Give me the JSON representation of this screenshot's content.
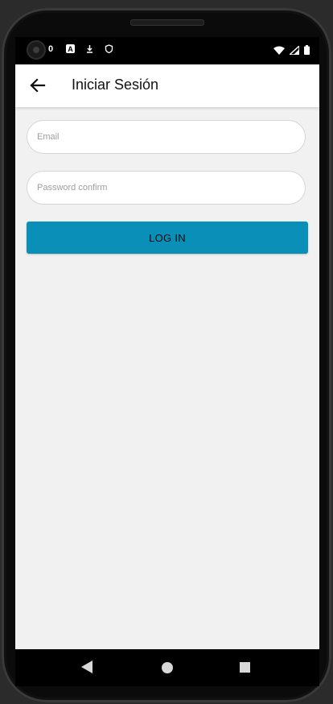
{
  "status_bar": {
    "left_text": "0",
    "icons": [
      "camera-icon",
      "a-icon",
      "download-icon",
      "shield-icon"
    ],
    "right_icons": [
      "wifi-icon",
      "signal-icon",
      "battery-icon"
    ]
  },
  "app_bar": {
    "back_icon": "arrow-back-icon",
    "title": "Iniciar Sesión"
  },
  "form": {
    "email_placeholder": "Email",
    "password_placeholder": "Password confirm",
    "login_label": "LOG IN"
  },
  "colors": {
    "accent": "#0a90b8",
    "screen_bg": "#f1f1f1"
  },
  "nav_bar": {
    "buttons": [
      "back-triangle-icon",
      "home-circle-icon",
      "recents-square-icon"
    ]
  }
}
